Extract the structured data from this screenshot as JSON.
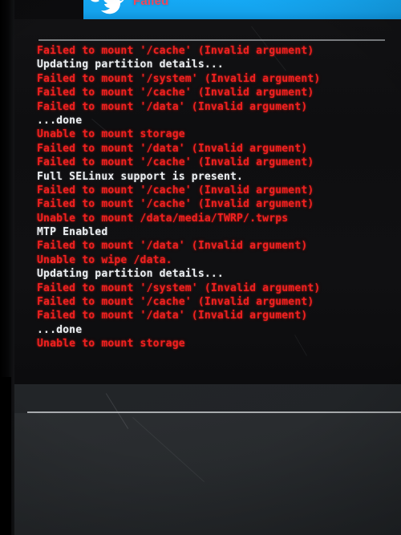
{
  "banner": {
    "app_icon": "twitter-bird-icon",
    "title": "Failed",
    "accent_color": "#14a2ec",
    "title_color": "#f0485c"
  },
  "console": {
    "background_color": "#0e0e10",
    "error_color": "#ef2020",
    "info_color": "#eceff2",
    "lines": [
      {
        "text": "Failed to mount '/cache' (Invalid argument)",
        "level": "error"
      },
      {
        "text": "Updating partition details...",
        "level": "info"
      },
      {
        "text": "Failed to mount '/system' (Invalid argument)",
        "level": "error"
      },
      {
        "text": "Failed to mount '/cache' (Invalid argument)",
        "level": "error"
      },
      {
        "text": "Failed to mount '/data' (Invalid argument)",
        "level": "error"
      },
      {
        "text": "...done",
        "level": "info"
      },
      {
        "text": "Unable to mount storage",
        "level": "error"
      },
      {
        "text": "Failed to mount '/data' (Invalid argument)",
        "level": "error"
      },
      {
        "text": "Failed to mount '/cache' (Invalid argument)",
        "level": "error"
      },
      {
        "text": "Full SELinux support is present.",
        "level": "info"
      },
      {
        "text": "Failed to mount '/cache' (Invalid argument)",
        "level": "error"
      },
      {
        "text": "Failed to mount '/cache' (Invalid argument)",
        "level": "error"
      },
      {
        "text": "Unable to mount /data/media/TWRP/.twrps",
        "level": "error"
      },
      {
        "text": "MTP Enabled",
        "level": "info"
      },
      {
        "text": "Failed to mount '/data' (Invalid argument)",
        "level": "error"
      },
      {
        "text": "Unable to wipe /data.",
        "level": "error"
      },
      {
        "text": "Updating partition details...",
        "level": "info"
      },
      {
        "text": "Failed to mount '/system' (Invalid argument)",
        "level": "error"
      },
      {
        "text": "Failed to mount '/cache' (Invalid argument)",
        "level": "error"
      },
      {
        "text": "Failed to mount '/data' (Invalid argument)",
        "level": "error"
      },
      {
        "text": "...done",
        "level": "info"
      },
      {
        "text": "Unable to mount storage",
        "level": "error"
      }
    ]
  }
}
